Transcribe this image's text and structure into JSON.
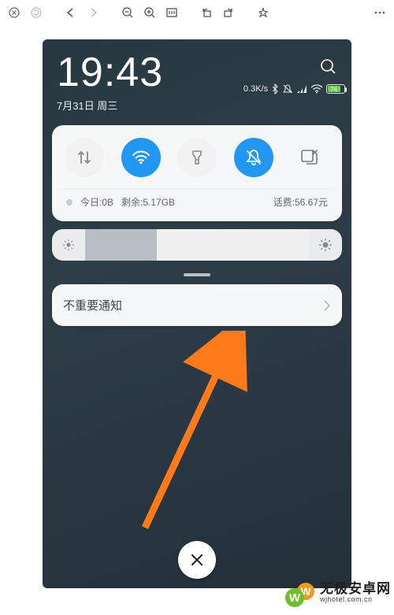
{
  "viewer": {
    "tools": [
      "close",
      "refresh",
      "back",
      "forward",
      "zoom-out",
      "zoom-in",
      "actual-size",
      "rotate-left",
      "rotate-right",
      "highlight",
      "more"
    ]
  },
  "phone": {
    "time": "19:43",
    "date": "7月31日 周三",
    "network_speed": "0.3K/s",
    "status_icons": [
      "bluetooth",
      "silent",
      "signal",
      "wifi"
    ],
    "battery_percent": 74,
    "toggles": [
      {
        "name": "mobile-data",
        "active": false
      },
      {
        "name": "wifi",
        "active": true
      },
      {
        "name": "flashlight",
        "active": false
      },
      {
        "name": "mute-notifications",
        "active": true
      },
      {
        "name": "screenshot",
        "active": false,
        "plain": true
      }
    ],
    "usage": {
      "today_label": "今日:0B",
      "remaining_label": "剩余:5.17GB",
      "balance_label": "话费:56.67元"
    },
    "brightness_percent": 32,
    "notification_label": "不重要通知"
  },
  "watermark": {
    "cn": "无极安卓网",
    "en": "wjhotel.com.cn"
  },
  "colors": {
    "accent": "#2196f3",
    "arrow": "#ff7a1a",
    "battery_fill": "#6ed14a",
    "wm_green": "#6dbf2c",
    "wm_orange": "#f39a1f"
  }
}
